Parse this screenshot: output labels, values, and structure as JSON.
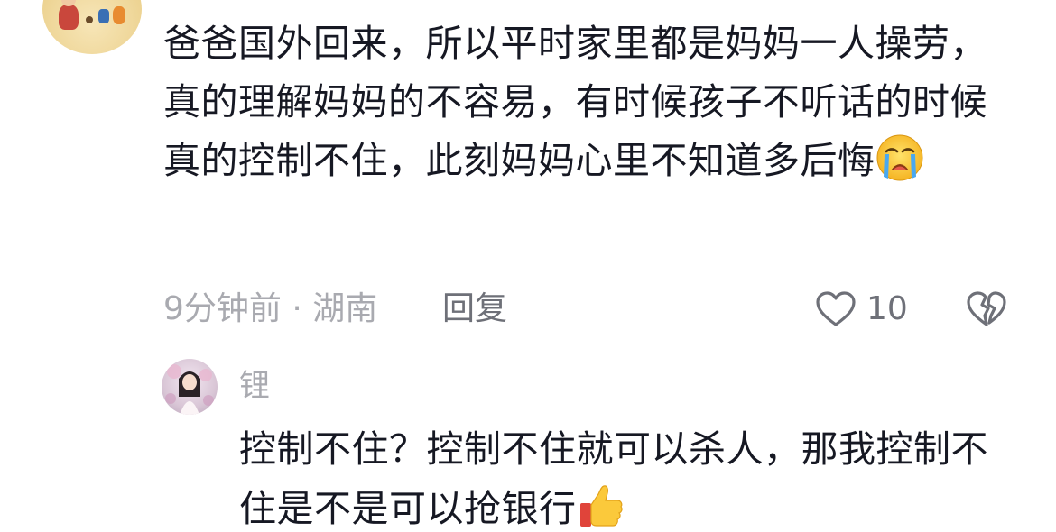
{
  "comment": {
    "text": "爸爸国外回来，所以平时家里都是妈妈一人操劳，真的理解妈妈的不容易，有时候孩子不听话的时候真的控制不住，此刻妈妈心里不知道多后悔",
    "emoji": "loudly-crying-face",
    "time_location": "9分钟前 · 湖南",
    "reply_label": "回复",
    "like_count": "10"
  },
  "reply": {
    "author": "锂",
    "text": "控制不住？控制不住就可以杀人，那我控制不住是不是可以抢银行",
    "emoji": "thumbs-up"
  },
  "colors": {
    "text_primary": "#161823",
    "text_secondary": "#a9aab0",
    "background": "#ffffff"
  }
}
